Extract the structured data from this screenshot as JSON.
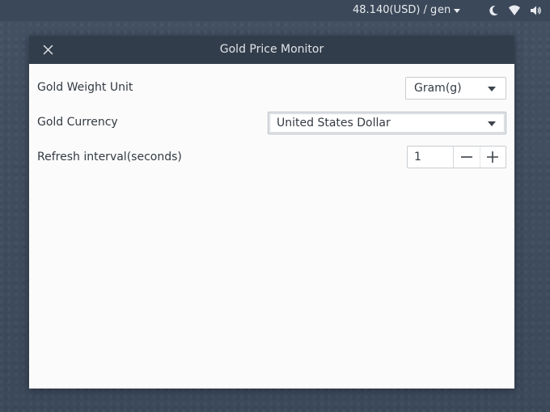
{
  "panel": {
    "price_text": "48.140(USD) / g",
    "language": "en",
    "icons": [
      "moon-icon",
      "wifi-icon",
      "volume-icon"
    ]
  },
  "window": {
    "title": "Gold Price Monitor",
    "close_icon": "close-icon"
  },
  "settings": {
    "weight_unit": {
      "label": "Gold Weight Unit",
      "value": "Gram(g)"
    },
    "currency": {
      "label": "Gold Currency",
      "value": "United States Dollar"
    },
    "refresh": {
      "label": "Refresh interval(seconds)",
      "value": "1",
      "decrement_icon": "minus-icon",
      "increment_icon": "plus-icon"
    }
  },
  "colors": {
    "desktop": "#3f4d60",
    "titlebar": "#323d4b",
    "window_bg": "#fbfbfb"
  }
}
